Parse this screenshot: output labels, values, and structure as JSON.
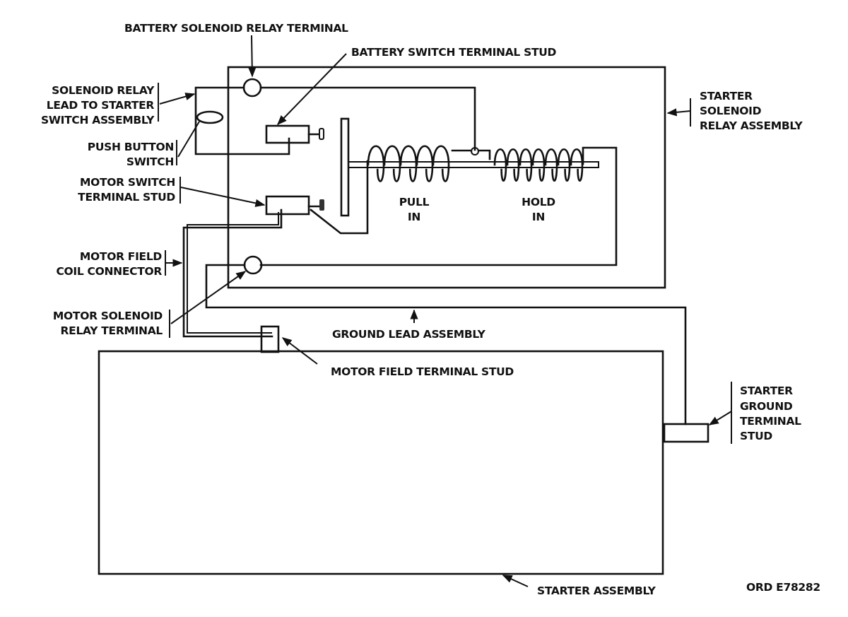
{
  "figure_id": "ORD E78282",
  "labels": {
    "battery_solenoid_relay_terminal": "BATTERY SOLENOID RELAY TERMINAL",
    "battery_switch_terminal_stud": "BATTERY SWITCH TERMINAL STUD",
    "solenoid_relay_lead": [
      "SOLENOID RELAY",
      "LEAD TO STARTER",
      "SWITCH ASSEMBLY"
    ],
    "push_button_switch": [
      "PUSH BUTTON",
      "SWITCH"
    ],
    "motor_switch_terminal_stud": [
      "MOTOR SWITCH",
      "TERMINAL STUD"
    ],
    "motor_field_coil_connector": [
      "MOTOR FIELD",
      "COIL CONNECTOR"
    ],
    "motor_solenoid_relay_terminal": [
      "MOTOR SOLENOID",
      "RELAY TERMINAL"
    ],
    "starter_solenoid_relay_assembly": [
      "STARTER",
      "SOLENOID",
      "RELAY ASSEMBLY"
    ],
    "pull_in": [
      "PULL",
      "IN"
    ],
    "hold_in": [
      "HOLD",
      "IN"
    ],
    "ground_lead_assembly": "GROUND LEAD ASSEMBLY",
    "motor_field_terminal_stud": "MOTOR FIELD TERMINAL STUD",
    "starter_ground_terminal_stud": [
      "STARTER",
      "GROUND",
      "TERMINAL",
      "STUD"
    ],
    "starter_assembly": "STARTER ASSEMBLY"
  }
}
